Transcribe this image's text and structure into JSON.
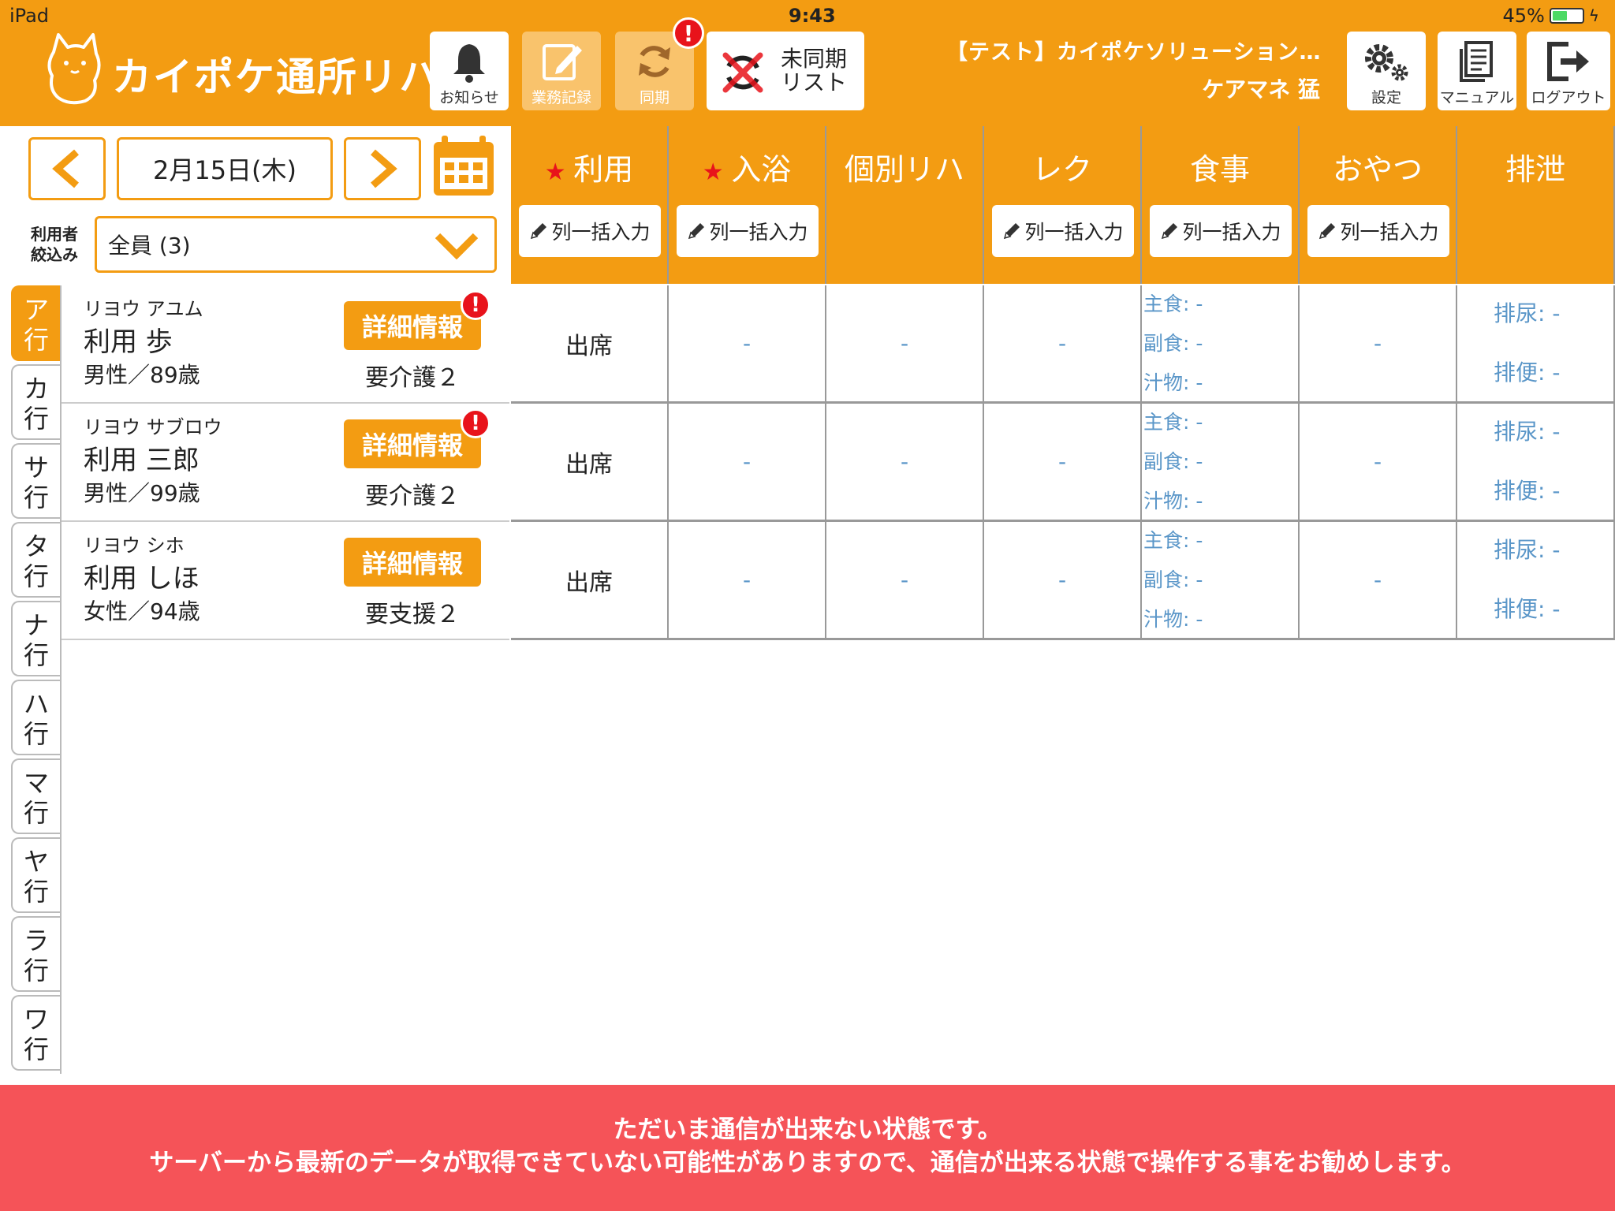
{
  "status_bar": {
    "device": "iPad",
    "time": "9:43",
    "battery": "45%"
  },
  "header": {
    "app_title": "カイポケ通所リハ",
    "buttons": {
      "notice": "お知らせ",
      "record": "業務記録",
      "sync": "同期",
      "unsync_list": "未同期\nリスト",
      "settings": "設定",
      "manual": "マニュアル",
      "logout": "ログアウト"
    },
    "sync_badge": "!",
    "facility_name": "【テスト】カイポケソリューション…",
    "user_name": "ケアマネ 猛"
  },
  "date_nav": {
    "date": "2月15日(木)"
  },
  "filter": {
    "label": "利用者\n絞込み",
    "value": "全員 (3)"
  },
  "kana_tabs": [
    "ア\n行",
    "カ\n行",
    "サ\n行",
    "タ\n行",
    "ナ\n行",
    "ハ\n行",
    "マ\n行",
    "ヤ\n行",
    "ラ\n行",
    "ワ\n行"
  ],
  "active_kana_tab": 0,
  "detail_button_label": "詳細情報",
  "bulk_input_label": "列一括入力",
  "columns": [
    {
      "title": "利用",
      "required": true,
      "bulk": true
    },
    {
      "title": "入浴",
      "required": true,
      "bulk": true
    },
    {
      "title": "個別リハ",
      "required": false,
      "bulk": false
    },
    {
      "title": "レク",
      "required": false,
      "bulk": true
    },
    {
      "title": "食事",
      "required": false,
      "bulk": true
    },
    {
      "title": "おやつ",
      "required": false,
      "bulk": true
    },
    {
      "title": "排泄",
      "required": false,
      "bulk": false
    }
  ],
  "meal_labels": [
    "主食:",
    "副食:",
    "汁物:"
  ],
  "excretion_labels": [
    "排尿:",
    "排便:"
  ],
  "empty_value": "-",
  "users": [
    {
      "kana": "リヨウ アユム",
      "name": "利用 歩",
      "info": "男性／89歳",
      "care_level": "要介護２",
      "alert": true,
      "attendance": "出席"
    },
    {
      "kana": "リヨウ サブロウ",
      "name": "利用 三郎",
      "info": "男性／99歳",
      "care_level": "要介護２",
      "alert": true,
      "attendance": "出席"
    },
    {
      "kana": "リヨウ シホ",
      "name": "利用 しほ",
      "info": "女性／94歳",
      "care_level": "要支援２",
      "alert": false,
      "attendance": "出席"
    }
  ],
  "offline_banner": {
    "line1": "ただいま通信が出来ない状態です。",
    "line2": "サーバーから最新のデータが取得できていない可能性がありますので、通信が出来る状態で操作する事をお勧めします。"
  },
  "colors": {
    "accent": "#f39c12",
    "alert": "#e8131b",
    "banner": "#f55358",
    "value_text": "#5a96c8"
  }
}
